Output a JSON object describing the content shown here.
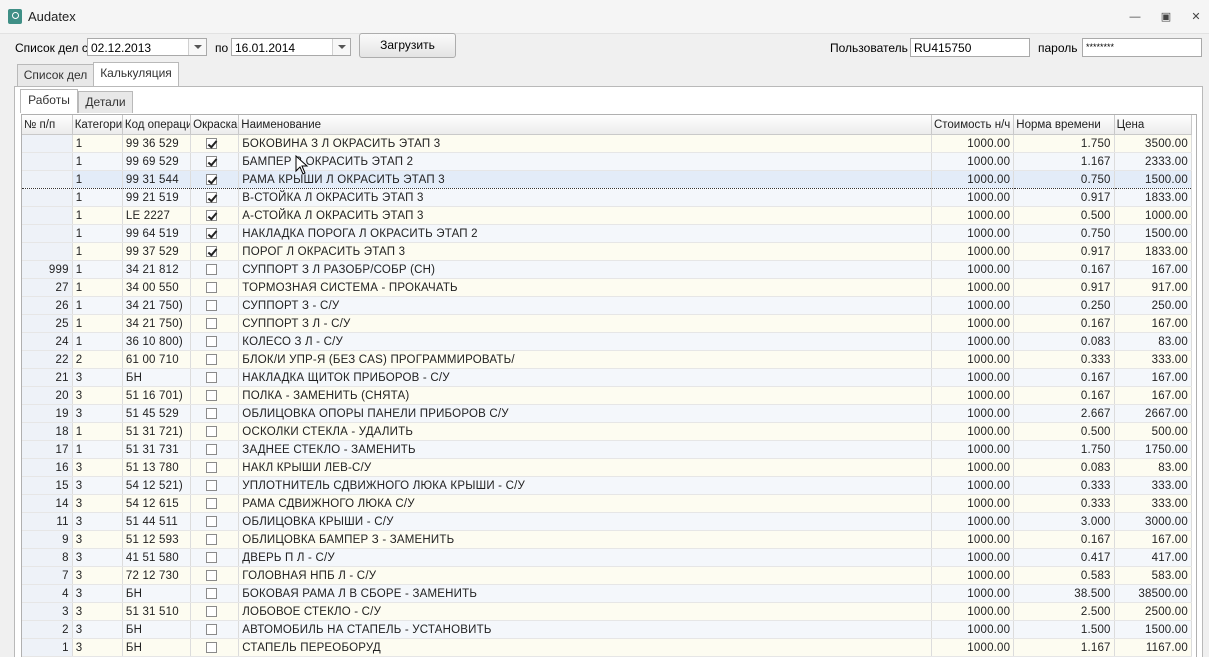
{
  "window": {
    "title": "Audatex"
  },
  "filters": {
    "from_label": "Список дел с",
    "from_date": "02.12.2013",
    "to_label": "по",
    "to_date": "16.01.2014",
    "load_button": "Загрузить",
    "user_label": "Пользователь",
    "user_value": "RU415750",
    "password_label": "пароль",
    "password_value": "********"
  },
  "main_tabs": [
    {
      "label": "Список дел"
    },
    {
      "label": "Калькуляция"
    }
  ],
  "sub_tabs": [
    {
      "label": "Работы"
    },
    {
      "label": "Детали"
    }
  ],
  "table": {
    "headers": [
      "№ п/п",
      "Категори",
      "Код операци",
      "Окраска",
      "Наименование",
      "Стоимость н/ч",
      "Норма времени",
      "Цена"
    ],
    "selected_row": 2,
    "rows": [
      {
        "no": "",
        "cat": "1",
        "code": "99 36 529",
        "paint": true,
        "name": "БОКОВИНА З Л ОКРАСИТЬ ЭТАП 3",
        "rate": "1000.00",
        "norm": "1.750",
        "price": "3500.00"
      },
      {
        "no": "",
        "cat": "1",
        "code": "99 69 529",
        "paint": true,
        "name": "БАМПЕР З ОКРАСИТЬ ЭТАП 2",
        "rate": "1000.00",
        "norm": "1.167",
        "price": "2333.00"
      },
      {
        "no": "",
        "cat": "1",
        "code": "99 31 544",
        "paint": true,
        "name": "РАМА КРЫШИ Л ОКРАСИТЬ ЭТАП 3",
        "rate": "1000.00",
        "norm": "0.750",
        "price": "1500.00"
      },
      {
        "no": "",
        "cat": "1",
        "code": "99 21 519",
        "paint": true,
        "name": "B-СТОЙКА  Л ОКРАСИТЬ ЭТАП 3",
        "rate": "1000.00",
        "norm": "0.917",
        "price": "1833.00"
      },
      {
        "no": "",
        "cat": "1",
        "code": "LE  2227",
        "paint": true,
        "name": "A-СТОЙКА Л ОКРАСИТЬ ЭТАП 3",
        "rate": "1000.00",
        "norm": "0.500",
        "price": "1000.00"
      },
      {
        "no": "",
        "cat": "1",
        "code": "99 64 519",
        "paint": true,
        "name": "НАКЛАДКА ПОРОГА Л ОКРАСИТЬ ЭТАП 2",
        "rate": "1000.00",
        "norm": "0.750",
        "price": "1500.00"
      },
      {
        "no": "",
        "cat": "1",
        "code": "99 37 529",
        "paint": true,
        "name": "ПОРОГ Л ОКРАСИТЬ ЭТАП 3",
        "rate": "1000.00",
        "norm": "0.917",
        "price": "1833.00"
      },
      {
        "no": "999",
        "cat": "1",
        "code": "34 21 812",
        "paint": false,
        "name": "СУППОРТ З Л РАЗОБР/СОБР (СН)",
        "rate": "1000.00",
        "norm": "0.167",
        "price": "167.00"
      },
      {
        "no": "27",
        "cat": "1",
        "code": "34 00 550",
        "paint": false,
        "name": "ТОРМОЗНАЯ СИСТЕМА - ПРОКАЧАТЬ",
        "rate": "1000.00",
        "norm": "0.917",
        "price": "917.00"
      },
      {
        "no": "26",
        "cat": "1",
        "code": "34 21 750)",
        "paint": false,
        "name": "СУППОРТ З - С/У",
        "rate": "1000.00",
        "norm": "0.250",
        "price": "250.00"
      },
      {
        "no": "25",
        "cat": "1",
        "code": "34 21 750)",
        "paint": false,
        "name": "СУППОРТ З Л - С/У",
        "rate": "1000.00",
        "norm": "0.167",
        "price": "167.00"
      },
      {
        "no": "24",
        "cat": "1",
        "code": "36 10 800)",
        "paint": false,
        "name": "КОЛЕСО З Л - С/У",
        "rate": "1000.00",
        "norm": "0.083",
        "price": "83.00"
      },
      {
        "no": "22",
        "cat": "2",
        "code": "61 00 710",
        "paint": false,
        "name": "БЛОК/И УПР-Я (БЕЗ CAS) ПРОГРАММИРОВАТЬ/",
        "rate": "1000.00",
        "norm": "0.333",
        "price": "333.00"
      },
      {
        "no": "21",
        "cat": "3",
        "code": "БН",
        "paint": false,
        "name": "НАКЛАДКА ЩИТОК ПРИБОРОВ - С/У",
        "rate": "1000.00",
        "norm": "0.167",
        "price": "167.00"
      },
      {
        "no": "20",
        "cat": "3",
        "code": "51 16 701)",
        "paint": false,
        "name": "ПОЛКА - ЗАМЕНИТЬ (СНЯТА)",
        "rate": "1000.00",
        "norm": "0.167",
        "price": "167.00"
      },
      {
        "no": "19",
        "cat": "3",
        "code": "51 45 529",
        "paint": false,
        "name": "ОБЛИЦОВКА ОПОРЫ ПАНЕЛИ ПРИБОРОВ С/У",
        "rate": "1000.00",
        "norm": "2.667",
        "price": "2667.00"
      },
      {
        "no": "18",
        "cat": "1",
        "code": "51 31 721)",
        "paint": false,
        "name": "ОСКОЛКИ СТЕКЛА - УДАЛИТЬ",
        "rate": "1000.00",
        "norm": "0.500",
        "price": "500.00"
      },
      {
        "no": "17",
        "cat": "1",
        "code": "51 31 731",
        "paint": false,
        "name": "ЗАДНЕЕ СТЕКЛО - ЗАМЕНИТЬ",
        "rate": "1000.00",
        "norm": "1.750",
        "price": "1750.00"
      },
      {
        "no": "16",
        "cat": "3",
        "code": "51 13 780",
        "paint": false,
        "name": "НАКЛ  КРЫШИ ЛЕВ-С/У",
        "rate": "1000.00",
        "norm": "0.083",
        "price": "83.00"
      },
      {
        "no": "15",
        "cat": "3",
        "code": "54 12 521)",
        "paint": false,
        "name": "УПЛОТНИТЕЛЬ СДВИЖНОГО ЛЮКА КРЫШИ - С/У",
        "rate": "1000.00",
        "norm": "0.333",
        "price": "333.00"
      },
      {
        "no": "14",
        "cat": "3",
        "code": "54 12 615",
        "paint": false,
        "name": "РАМА СДВИЖНОГО ЛЮКА С/У",
        "rate": "1000.00",
        "norm": "0.333",
        "price": "333.00"
      },
      {
        "no": "11",
        "cat": "3",
        "code": "51 44 511",
        "paint": false,
        "name": "ОБЛИЦОВКА КРЫШИ - С/У",
        "rate": "1000.00",
        "norm": "3.000",
        "price": "3000.00"
      },
      {
        "no": "9",
        "cat": "3",
        "code": "51 12 593",
        "paint": false,
        "name": "ОБЛИЦОВКА БАМПЕР З - ЗАМЕНИТЬ",
        "rate": "1000.00",
        "norm": "0.167",
        "price": "167.00"
      },
      {
        "no": "8",
        "cat": "3",
        "code": "41 51 580",
        "paint": false,
        "name": "ДВЕРЬ П Л - С/У",
        "rate": "1000.00",
        "norm": "0.417",
        "price": "417.00"
      },
      {
        "no": "7",
        "cat": "3",
        "code": "72 12 730",
        "paint": false,
        "name": "ГОЛОВНАЯ НПБ Л - С/У",
        "rate": "1000.00",
        "norm": "0.583",
        "price": "583.00"
      },
      {
        "no": "4",
        "cat": "3",
        "code": "БН",
        "paint": false,
        "name": "БОКОВАЯ РАМА Л В СБОРЕ - ЗАМЕНИТЬ",
        "rate": "1000.00",
        "norm": "38.500",
        "price": "38500.00"
      },
      {
        "no": "3",
        "cat": "3",
        "code": "51 31 510",
        "paint": false,
        "name": "ЛОБОВОЕ СТЕКЛО - С/У",
        "rate": "1000.00",
        "norm": "2.500",
        "price": "2500.00"
      },
      {
        "no": "2",
        "cat": "3",
        "code": "БН",
        "paint": false,
        "name": "АВТОМОБИЛЬ НА СТАПЕЛЬ - УСТАНОВИТЬ",
        "rate": "1000.00",
        "norm": "1.500",
        "price": "1500.00"
      },
      {
        "no": "1",
        "cat": "3",
        "code": "БН",
        "paint": false,
        "name": "СТАПЕЛЬ ПЕРЕОБОРУД",
        "rate": "1000.00",
        "norm": "1.167",
        "price": "1167.00"
      }
    ]
  }
}
